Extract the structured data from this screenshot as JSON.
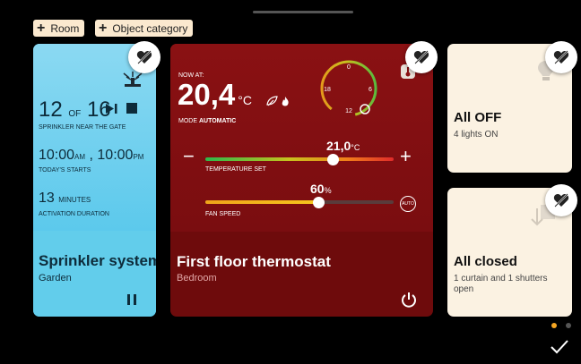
{
  "toolbar": {
    "add_room": "Room",
    "add_category": "Object category",
    "plus": "+"
  },
  "sprinkler": {
    "cycle_current": "12",
    "cycle_of": "OF",
    "cycle_total": "16",
    "zone_label": "SPRINKLER NEAR THE GATE",
    "start1_time": "10:00",
    "start1_ampm": "AM",
    "start_sep": ",",
    "start2_time": "10:00",
    "start2_ampm": "PM",
    "starts_label": "TODAY'S STARTS",
    "duration_value": "13",
    "duration_unit": "MINUTES",
    "duration_label": "ACTIVATION DURATION",
    "title": "Sprinkler system",
    "room": "Garden"
  },
  "thermostat": {
    "now_at_label": "NOW AT:",
    "current_temp": "20,4",
    "unit": "°C",
    "mode_label": "MODE",
    "mode_value": "AUTOMATIC",
    "gauge_ticks": [
      "0",
      "6",
      "12",
      "18"
    ],
    "gauge_level": 0.62,
    "setpoint": "21,0",
    "setpoint_unit": "°C",
    "setpoint_level": 0.68,
    "temp_set_label": "TEMPERATURE SET",
    "minus": "−",
    "plus": "+",
    "fan_value": "60",
    "fan_unit": "%",
    "fan_level": 0.6,
    "fan_label": "FAN SPEED",
    "auto_label": "AUTO",
    "title": "First floor thermostat",
    "room": "Bedroom"
  },
  "lights": {
    "title": "All OFF",
    "subtitle": "4 lights ON"
  },
  "shutters": {
    "title": "All closed",
    "subtitle": "1 curtain and 1 shutters open"
  },
  "pager": {
    "pages": 2,
    "active": 0
  },
  "colors": {
    "sprinkler": "#4dc3e6",
    "thermostat": "#7a0d10",
    "cream": "#fbf2e2",
    "pager_active": "#f5a623"
  }
}
